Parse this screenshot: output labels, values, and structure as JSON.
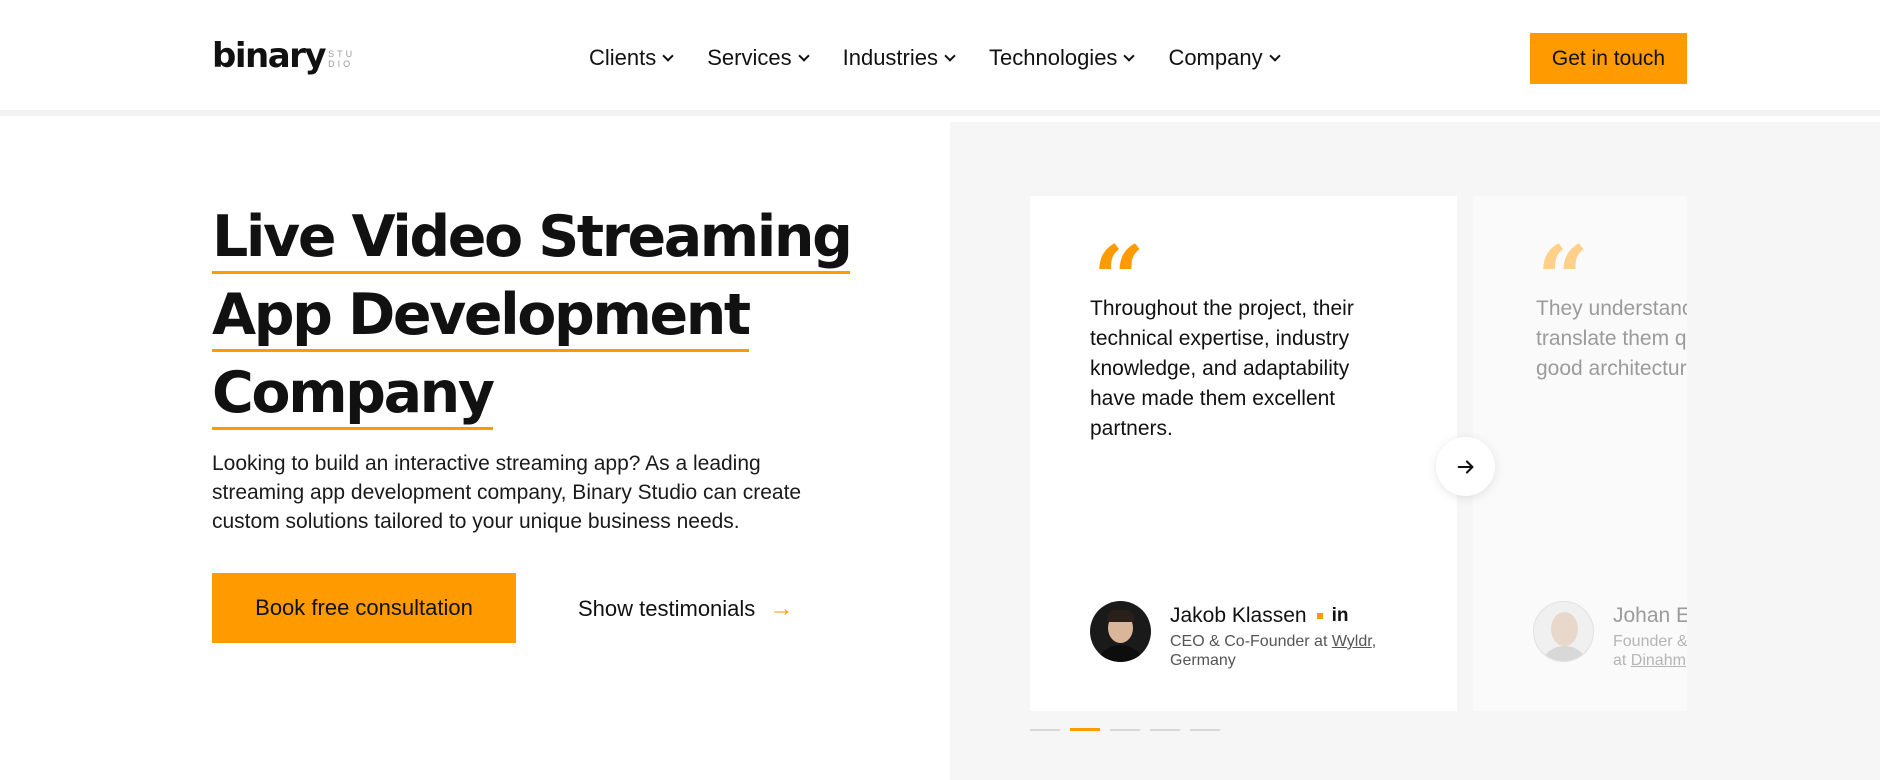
{
  "header": {
    "logo_text": "binary",
    "logo_sub_top": "STU",
    "logo_sub_bottom": "DIO",
    "nav": [
      {
        "label": "Clients"
      },
      {
        "label": "Services"
      },
      {
        "label": "Industries"
      },
      {
        "label": "Technologies"
      },
      {
        "label": "Company"
      }
    ],
    "cta_label": "Get in touch"
  },
  "hero": {
    "title_lines": [
      "Live Video Streaming",
      "App Development",
      "Company"
    ],
    "description": "Looking to build an interactive streaming app? As a leading streaming app development company, Binary Studio can create custom solutions tailored to your unique business needs.",
    "book_label": "Book free consultation",
    "show_label": "Show testimonials"
  },
  "testimonials": {
    "cards": [
      {
        "quote": "Throughout the project, their technical expertise, industry knowledge, and adaptability have made them excellent partners.",
        "name": "Jakob Klassen",
        "linkedin": "in",
        "role_prefix": "CEO & Co-Founder at ",
        "company": "Wyldr",
        "role_suffix": ", Germany"
      },
      {
        "quote_lines": [
          "They understanc",
          "translate them q",
          "good architectur"
        ],
        "name": "Johan E",
        "role_line1": "Founder &",
        "role_line2_prefix": "at ",
        "company": "Dinahm"
      }
    ],
    "dots_count": 5,
    "active_dot": 1
  },
  "colors": {
    "accent": "#ff9a00",
    "panel_bg": "#f6f6f6",
    "text": "#111111"
  }
}
